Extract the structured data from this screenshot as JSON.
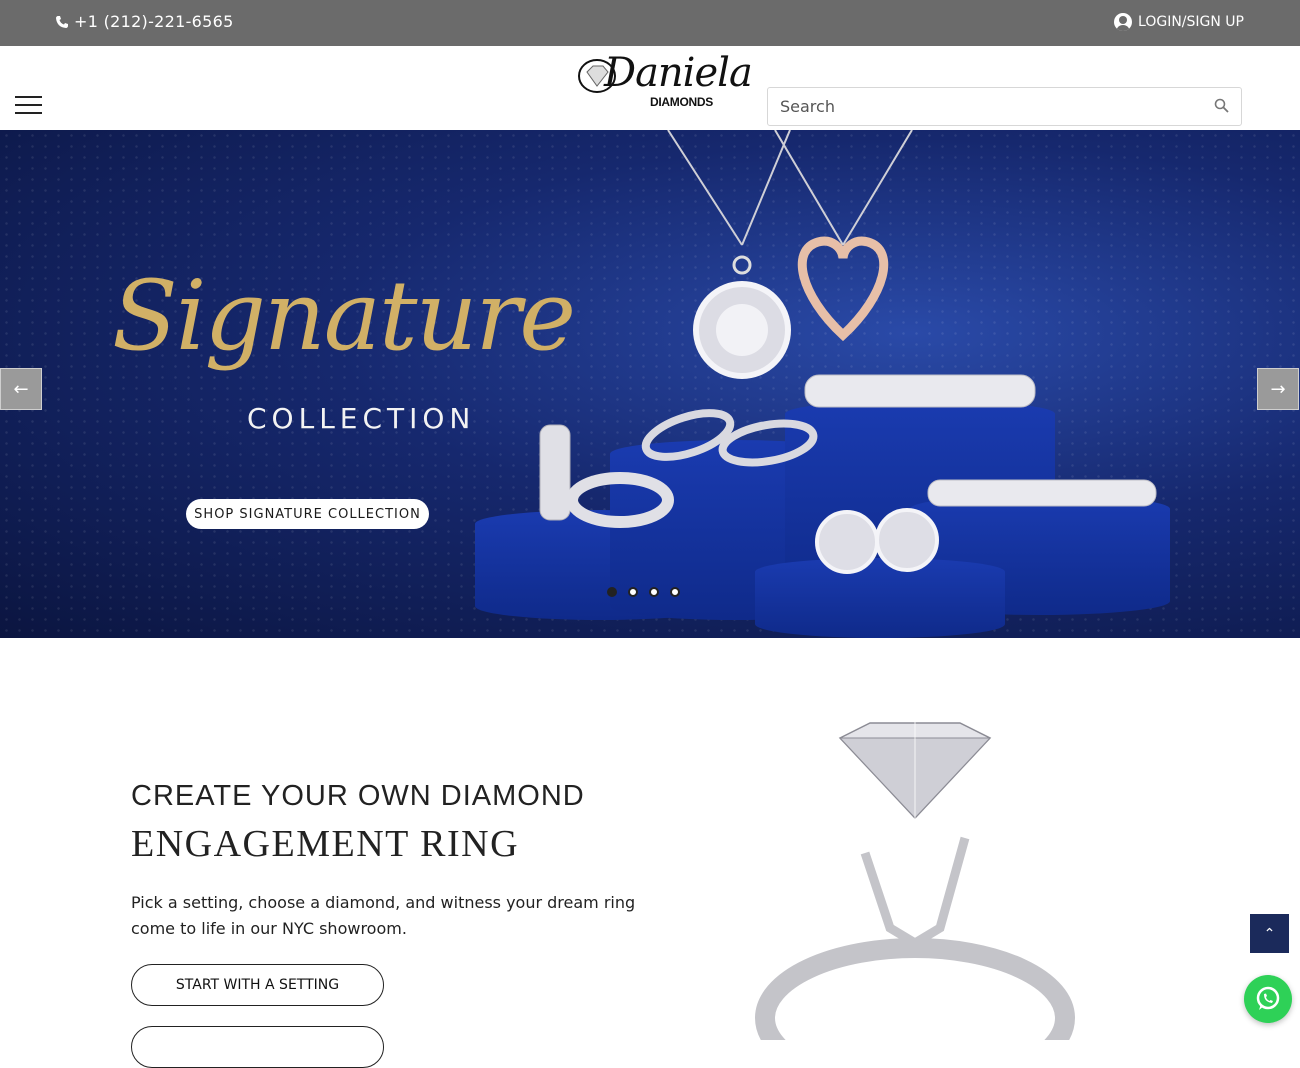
{
  "topbar": {
    "phone": "+1 (212)-221-6565",
    "login": "LOGIN/SIGN UP"
  },
  "logo": {
    "script": "Daniela",
    "sub": "DIAMONDS"
  },
  "search": {
    "placeholder": "Search"
  },
  "hero": {
    "title": "Signature",
    "subtitle": "COLLECTION",
    "cta": "SHOP SIGNATURE COLLECTION",
    "prev_arrow": "←",
    "next_arrow": "→",
    "slides_total": 4,
    "slide_active": 1
  },
  "section": {
    "eyebrow": "CREATE YOUR OWN DIAMOND",
    "heading": "ENGAGEMENT RING",
    "description": "Pick a setting, choose a diamond, and witness your dream ring come to life in our NYC showroom.",
    "button1": "START WITH A SETTING",
    "button2": ""
  },
  "floating": {
    "scroll_top": "⌃"
  },
  "colors": {
    "topbar": "#6b6b6b",
    "hero_bg": "#16286e",
    "gold": "#d1b066",
    "whatsapp": "#2ed157",
    "scroll_top": "#1b2a5b"
  },
  "icons": [
    "phone-icon",
    "user-icon",
    "menu-icon",
    "search-icon",
    "arrow-left-icon",
    "arrow-right-icon",
    "chevron-up-icon",
    "whatsapp-icon"
  ]
}
